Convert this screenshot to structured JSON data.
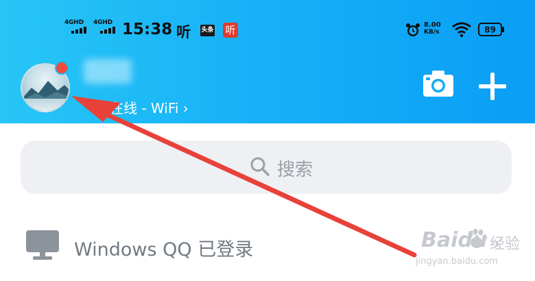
{
  "status_bar": {
    "network_1": "4GHD",
    "network_2": "4GHD",
    "time": "15:38",
    "ting_label": "听",
    "toutiao_label": "头条",
    "red_app_label": "听",
    "speed_value": "8.00",
    "speed_unit": "KB/s",
    "battery_level": "89"
  },
  "header": {
    "online_status": "在线 - WiFi ›",
    "accent_color": "#17b2f7"
  },
  "search": {
    "placeholder": "搜索"
  },
  "list": {
    "windows_qq_label": "Windows QQ 已登录",
    "chevron": "›"
  },
  "annotation": {
    "arrow_color": "#e8413a"
  },
  "watermark": {
    "brand": "Baidu",
    "brand_cn": "经验",
    "url": "jingyan.baidu.com"
  }
}
